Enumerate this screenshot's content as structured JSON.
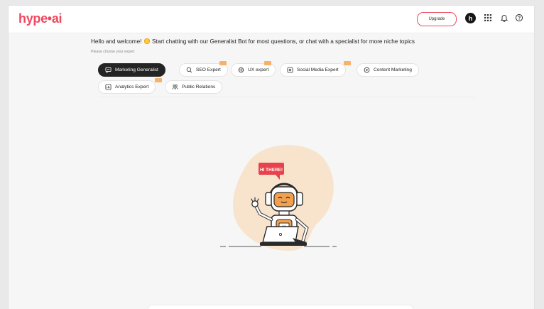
{
  "header": {
    "logo_text": "hype•ai",
    "upgrade_label": "Upgrade",
    "avatar_initial": "h",
    "icons": [
      "apps-grid-icon",
      "bell-icon",
      "help-icon"
    ]
  },
  "welcome": {
    "text_before": "Hello and welcome!",
    "text_after": "Start chatting with our Generalist Bot for most questions, or chat with a specialist for more niche topics",
    "choose_label": "Please choose your expert"
  },
  "experts": [
    {
      "label": "Marketing Generalist",
      "icon": "chat-icon",
      "active": true,
      "pro": false
    },
    {
      "label": "SEO Expert",
      "icon": "search-icon",
      "active": false,
      "pro": true
    },
    {
      "label": "UX expert",
      "icon": "compass-icon",
      "active": false,
      "pro": true
    },
    {
      "label": "Social Media Expert",
      "icon": "at-icon",
      "active": false,
      "pro": true
    },
    {
      "label": "Content Marketing",
      "icon": "document-icon",
      "active": false,
      "pro": false
    },
    {
      "label": "Analytics Expert",
      "icon": "chart-icon",
      "active": false,
      "pro": true
    },
    {
      "label": "Public Relations",
      "icon": "people-icon",
      "active": false,
      "pro": false
    }
  ],
  "illustration": {
    "speech_bubble": "HI THERE!",
    "screen_label": "ooo"
  },
  "colors": {
    "brand": "#f0485f",
    "active_chip": "#242424",
    "pro_badge": "#f5b26b",
    "blob": "#f8e3cd",
    "robot_orange": "#f2a04e"
  }
}
